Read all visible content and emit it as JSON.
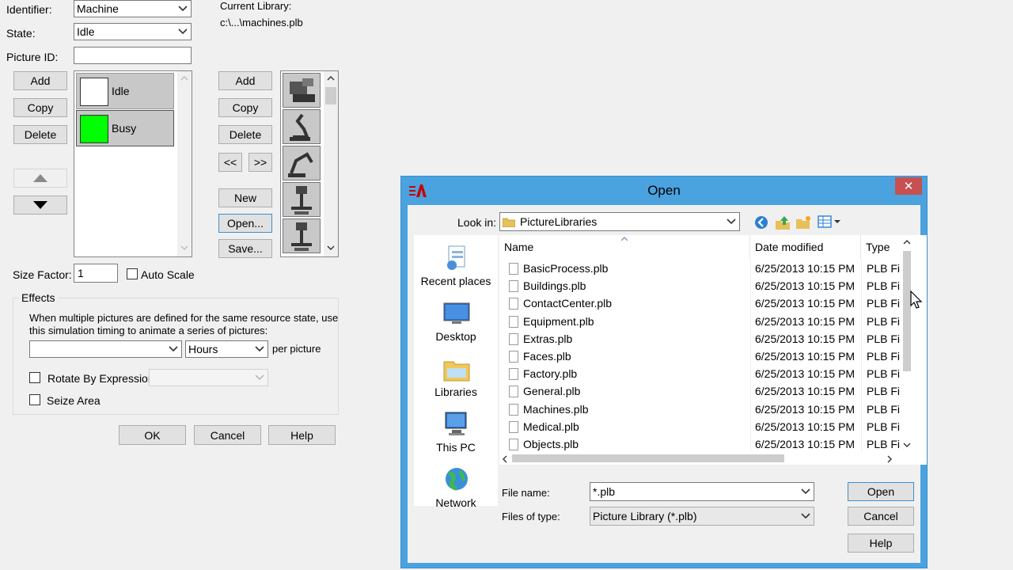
{
  "form": {
    "identifier_label": "Identifier:",
    "identifier_value": "Machine",
    "state_label": "State:",
    "state_value": "Idle",
    "picture_id_label": "Picture ID:",
    "picture_id_value": "",
    "current_library_label": "Current Library:",
    "current_library_path": "c:\\...\\machines.plb",
    "state_buttons": {
      "add": "Add",
      "copy": "Copy",
      "delete": "Delete"
    },
    "states": [
      {
        "label": "Idle",
        "color": "#ffffff"
      },
      {
        "label": "Busy",
        "color": "#00ff00"
      }
    ],
    "library_buttons": {
      "add": "Add",
      "copy": "Copy",
      "delete": "Delete",
      "prev": "<<",
      "next": ">>",
      "new": "New",
      "open": "Open...",
      "save": "Save..."
    },
    "size_factor_label": "Size Factor:",
    "size_factor_value": "1",
    "auto_scale_label": "Auto Scale",
    "effects_label": "Effects",
    "effects_text_1": "When multiple pictures are defined for the same resource state, use",
    "effects_text_2": "this simulation timing to animate a series of pictures:",
    "timing_value": "",
    "timing_unit": "Hours",
    "per_picture_label": "per picture",
    "rotate_label": "Rotate By Expression:",
    "rotate_value": "",
    "seize_label": "Seize Area",
    "ok": "OK",
    "cancel": "Cancel",
    "help": "Help"
  },
  "open_dialog": {
    "title": "Open",
    "close_glyph": "✕",
    "look_in_label": "Look in:",
    "look_in_value": "PictureLibraries",
    "places": [
      "Recent places",
      "Desktop",
      "Libraries",
      "This PC",
      "Network"
    ],
    "columns": {
      "name": "Name",
      "date": "Date modified",
      "type": "Type"
    },
    "files": [
      {
        "name": "BasicProcess.plb",
        "date": "6/25/2013 10:15 PM",
        "type": "PLB File"
      },
      {
        "name": "Buildings.plb",
        "date": "6/25/2013 10:15 PM",
        "type": "PLB File"
      },
      {
        "name": "ContactCenter.plb",
        "date": "6/25/2013 10:15 PM",
        "type": "PLB File"
      },
      {
        "name": "Equipment.plb",
        "date": "6/25/2013 10:15 PM",
        "type": "PLB File"
      },
      {
        "name": "Extras.plb",
        "date": "6/25/2013 10:15 PM",
        "type": "PLB File"
      },
      {
        "name": "Faces.plb",
        "date": "6/25/2013 10:15 PM",
        "type": "PLB File"
      },
      {
        "name": "Factory.plb",
        "date": "6/25/2013 10:15 PM",
        "type": "PLB File"
      },
      {
        "name": "General.plb",
        "date": "6/25/2013 10:15 PM",
        "type": "PLB File"
      },
      {
        "name": "Machines.plb",
        "date": "6/25/2013 10:15 PM",
        "type": "PLB File"
      },
      {
        "name": "Medical.plb",
        "date": "6/25/2013 10:15 PM",
        "type": "PLB File"
      },
      {
        "name": "Objects.plb",
        "date": "6/25/2013 10:15 PM",
        "type": "PLB File"
      }
    ],
    "file_name_label": "File name:",
    "file_name_value": "*.plb",
    "files_of_type_label": "Files of type:",
    "files_of_type_value": "Picture Library (*.plb)",
    "open_button": "Open",
    "cancel_button": "Cancel",
    "help_button": "Help"
  },
  "colors": {
    "dialog_frame": "#4aa3df",
    "close_button": "#c75050",
    "busy_state": "#00ff00"
  }
}
